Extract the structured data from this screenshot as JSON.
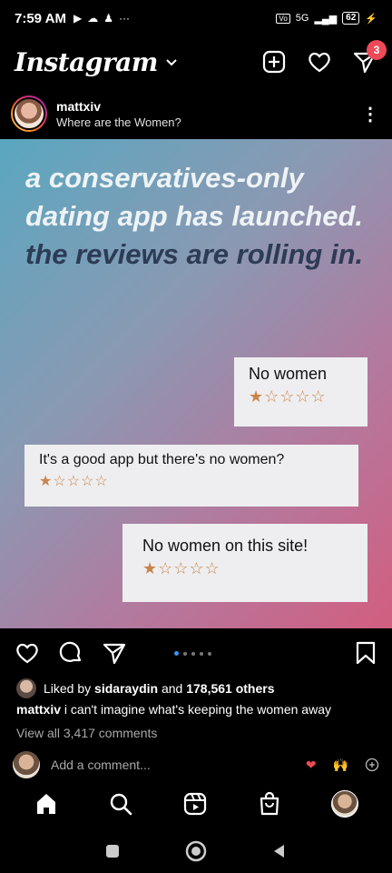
{
  "statusbar": {
    "time": "7:59 AM",
    "network": "5G",
    "battery": "62"
  },
  "topbar": {
    "logo": "Instagram",
    "messages_badge": "3"
  },
  "post": {
    "username": "mattxiv",
    "subtitle": "Where are the Women?",
    "headline_light": "a conservatives-only dating app has launched.",
    "headline_dark": "the reviews are rolling in.",
    "reviews": [
      {
        "text": "No women",
        "stars": "★☆☆☆☆",
        "rating": 1
      },
      {
        "text": "It's a good app but there's no women?",
        "stars": "★☆☆☆☆",
        "rating": 1
      },
      {
        "text": "No women on this site!",
        "stars": "★☆☆☆☆",
        "rating": 1
      }
    ],
    "liked_by_prefix": "Liked by",
    "liked_by_user": "sidaraydin",
    "liked_by_and": "and",
    "liked_by_others": "178,561 others",
    "caption_user": "mattxiv",
    "caption_text": "i can't imagine what's keeping the women away",
    "view_all": "View all 3,417 comments",
    "add_comment": "Add a comment..."
  },
  "colors": {
    "accent_blue": "#3897f0",
    "badge_red": "#ed4956",
    "star_orange": "#c8844c",
    "headline_dark": "#2d3b55"
  },
  "icons": {
    "topbar": [
      "plus-square-icon",
      "heart-icon",
      "send-icon"
    ],
    "actions": [
      "heart-icon",
      "comment-icon",
      "share-icon",
      "bookmark-icon"
    ],
    "bottomnav": [
      "home-icon",
      "search-icon",
      "reels-icon",
      "shop-icon",
      "profile-avatar"
    ],
    "sysnav": [
      "recents-icon",
      "home-circle-icon",
      "back-icon"
    ]
  }
}
